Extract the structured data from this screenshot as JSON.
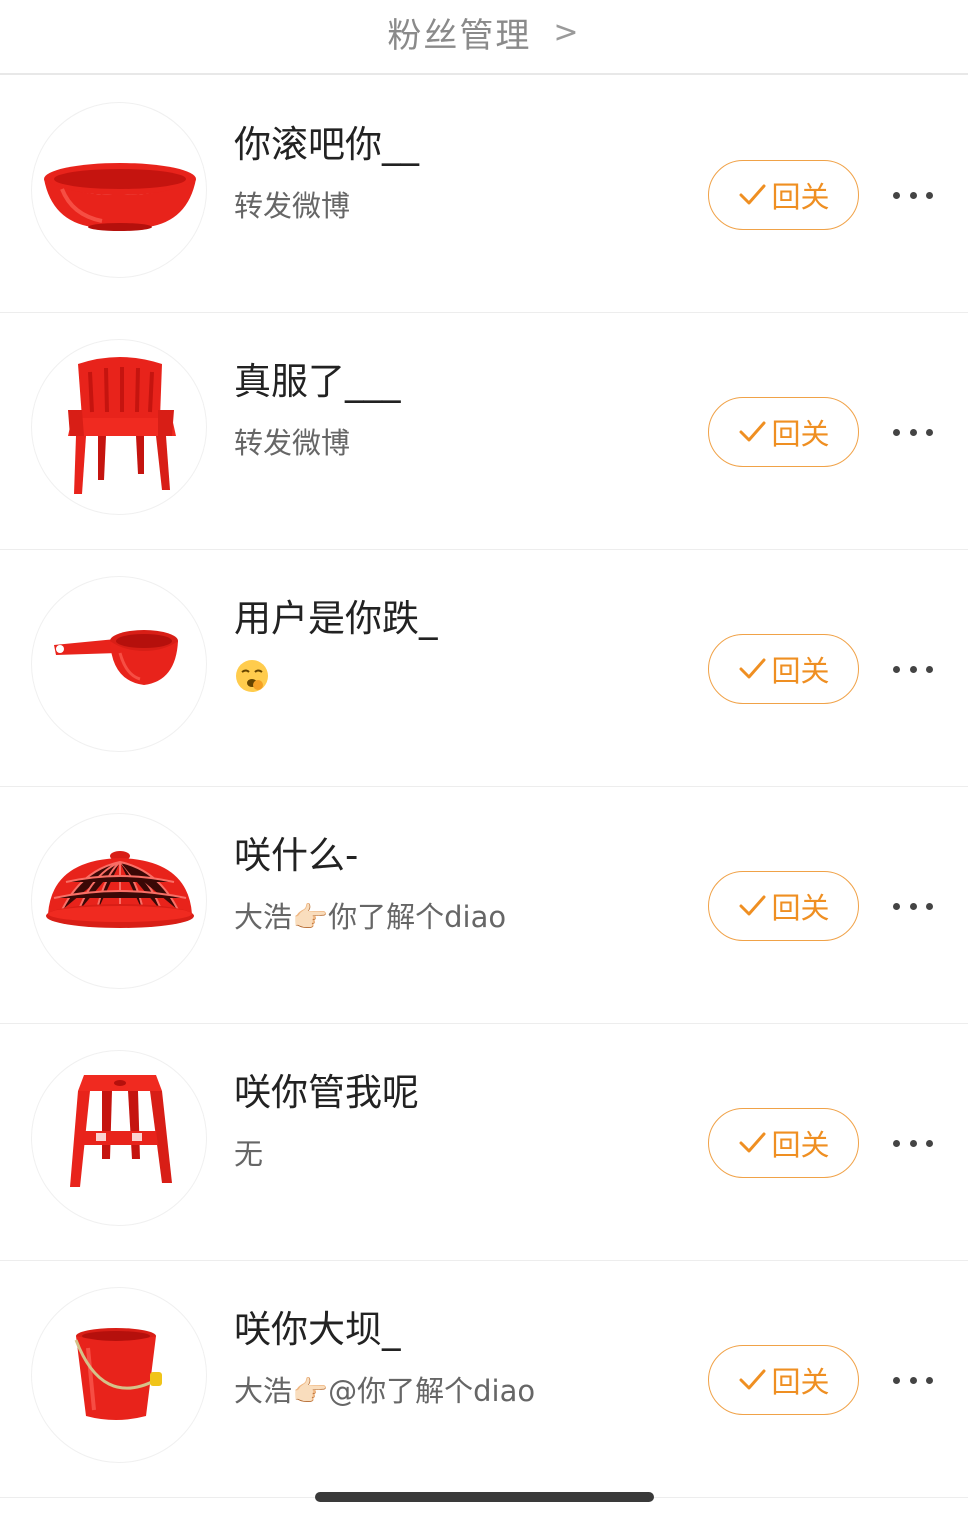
{
  "header": {
    "title": "粉丝管理",
    "arrow": ">"
  },
  "followers": [
    {
      "name": "你滚吧你__",
      "desc": "转发微博",
      "avatar_icon": "red-basin-icon",
      "button_label": "回关"
    },
    {
      "name": "真服了___",
      "desc": "转发微博",
      "avatar_icon": "red-chair-icon",
      "button_label": "回关"
    },
    {
      "name": "用户是你跌_",
      "desc": "🥱",
      "avatar_icon": "red-ladle-icon",
      "button_label": "回关"
    },
    {
      "name": "咲什么-",
      "desc": "大浩👉🏻你了解个diao",
      "avatar_icon": "red-food-cover-icon",
      "button_label": "回关"
    },
    {
      "name": "咲你管我呢",
      "desc": "无",
      "avatar_icon": "red-stool-icon",
      "button_label": "回关"
    },
    {
      "name": "咲你大坝_",
      "desc": "大浩👉🏻@你了解个diao",
      "avatar_icon": "red-bucket-icon",
      "button_label": "回关"
    }
  ],
  "colors": {
    "accent": "#ef8f22",
    "accent_border": "#f0a248",
    "item_red": "#e8231b"
  }
}
